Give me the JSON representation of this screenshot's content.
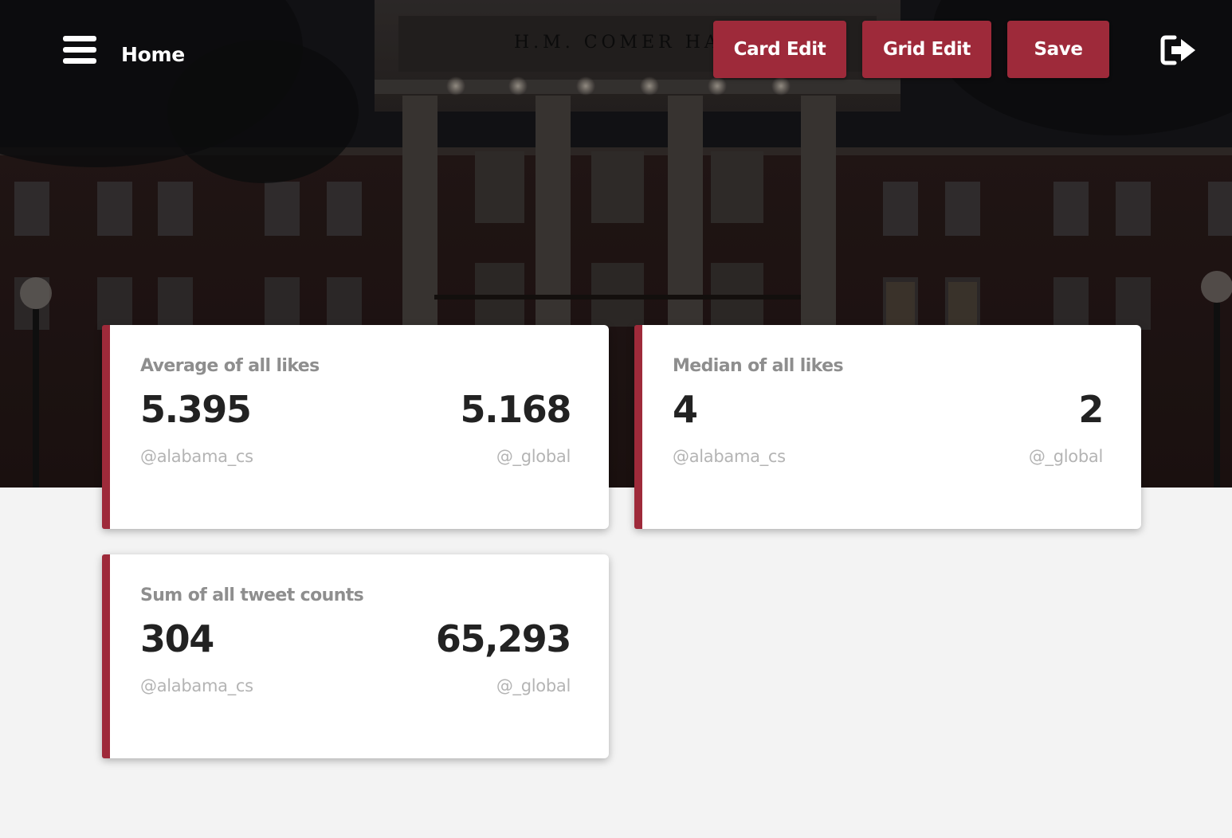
{
  "header": {
    "title": "Home",
    "buttons": {
      "card_edit": "Card Edit",
      "grid_edit": "Grid Edit",
      "save": "Save"
    },
    "icons": {
      "menu": "hamburger-menu-icon",
      "logout": "logout-icon"
    }
  },
  "hero": {
    "building_inscription": "H.M. COMER HAL"
  },
  "colors": {
    "accent": "#9e2a3a",
    "background": "#f3f3f3",
    "card": "#ffffff"
  },
  "cards": [
    {
      "title": "Average of all likes",
      "left_value": "5.395",
      "right_value": "5.168",
      "left_handle": "@alabama_cs",
      "right_handle": "@_global"
    },
    {
      "title": "Median of all likes",
      "left_value": "4",
      "right_value": "2",
      "left_handle": "@alabama_cs",
      "right_handle": "@_global"
    },
    {
      "title": "Sum of all tweet counts",
      "left_value": "304",
      "right_value": "65,293",
      "left_handle": "@alabama_cs",
      "right_handle": "@_global"
    }
  ]
}
